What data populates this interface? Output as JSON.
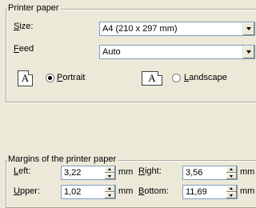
{
  "printer_paper": {
    "legend": "Printer paper",
    "size_label": "Size:",
    "size_value": "A4 (210 x 297 mm)",
    "feed_label": "Feed",
    "feed_value": "Auto",
    "portrait_label": "Portrait",
    "landscape_label": "Landscape",
    "page_icon_letter": "A",
    "selected_orientation": "Portrait"
  },
  "margins": {
    "legend": "Margins of the printer paper",
    "unit": "mm",
    "left_label": "Left:",
    "left_value": "3,22",
    "right_label": "Right:",
    "right_value": "3,56",
    "upper_label": "Upper:",
    "upper_value": "1,02",
    "bottom_label": "Bottom:",
    "bottom_value": "11,69"
  },
  "icons": {
    "dropdown": "chevron-down-icon",
    "spin_up": "spin-up-icon",
    "spin_down": "spin-down-icon",
    "portrait_page": "portrait-page-icon",
    "landscape_page": "landscape-page-icon"
  },
  "colors": {
    "dialog_bg": "#ece9d8",
    "field_border": "#7f9db9",
    "group_border": "#aca899"
  }
}
